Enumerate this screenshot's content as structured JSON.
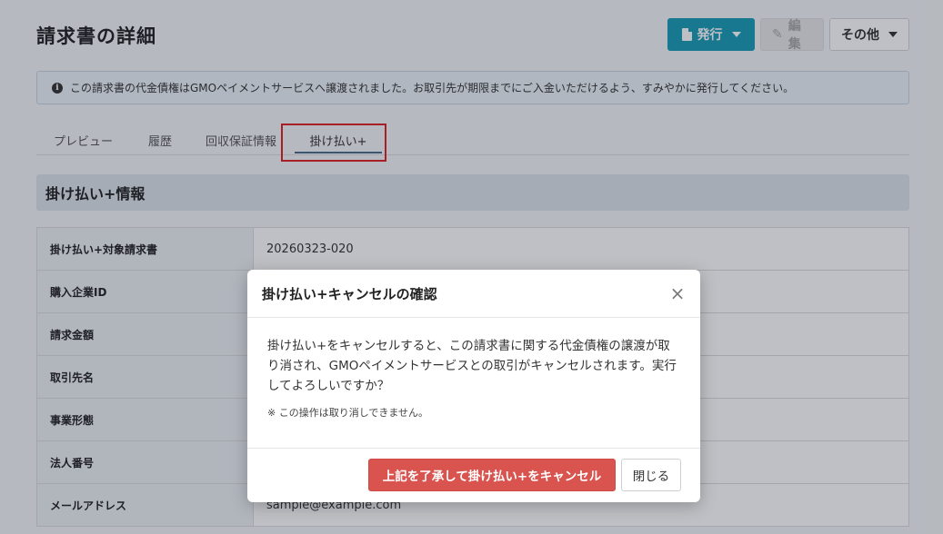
{
  "page": {
    "title": "請求書の詳細"
  },
  "toolbar": {
    "issue_label": "発行",
    "edit_label": "編集",
    "other_label": "その他"
  },
  "alert": {
    "message": "この請求書の代金債権はGMOペイメントサービスへ譲渡されました。お取引先が期限までにご入金いただけるよう、すみやかに発行してください。"
  },
  "tabs": [
    {
      "label": "プレビュー"
    },
    {
      "label": "履歴"
    },
    {
      "label": "回収保証情報"
    },
    {
      "label": "掛け払い+",
      "active": true
    }
  ],
  "section": {
    "title": "掛け払い+情報"
  },
  "info_rows": [
    {
      "label": "掛け払い+対象請求書",
      "value": "20260323-020"
    },
    {
      "label": "購入企業ID",
      "value": ""
    },
    {
      "label": "請求金額",
      "value": ""
    },
    {
      "label": "取引先名",
      "value": ""
    },
    {
      "label": "事業形態",
      "value": ""
    },
    {
      "label": "法人番号",
      "value": ""
    },
    {
      "label": "メールアドレス",
      "value": "sample@example.com"
    }
  ],
  "modal": {
    "title": "掛け払い+キャンセルの確認",
    "close_symbol": "×",
    "message": "掛け払い+をキャンセルすると、この請求書に関する代金債権の譲渡が取り消され、GMOペイメントサービスとの取引がキャンセルされます。実行してよろしいですか？",
    "note": "※ この操作は取り消しできません。",
    "confirm_label": "上記を了承して掛け払い+をキャンセル",
    "close_label": "閉じる"
  },
  "colors": {
    "primary": "#1a9bb5",
    "danger": "#d9534f",
    "highlight": "#e02020"
  }
}
